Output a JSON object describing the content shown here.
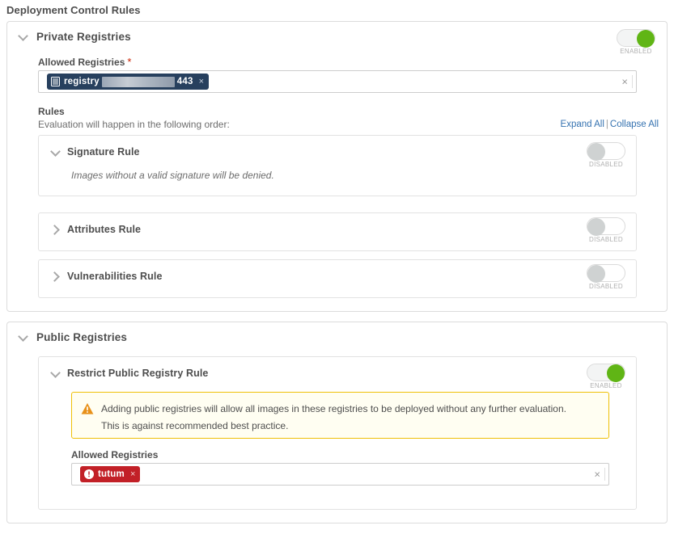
{
  "page": {
    "title": "Deployment Control Rules"
  },
  "private_section": {
    "title": "Private Registries",
    "chevron": "chevron-down-icon",
    "toggle": {
      "state": "on",
      "label": "ENABLED"
    },
    "allowed_registries": {
      "label": "Allowed Registries",
      "required_marker": "*",
      "clear_label": "×",
      "chips": [
        {
          "icon": "server-icon",
          "text_prefix": "registry",
          "redacted": true,
          "text_suffix": "443",
          "remove_label": "×"
        }
      ]
    },
    "rules": {
      "heading": "Rules",
      "subheading": "Evaluation will happen in the following order:",
      "expand_all": "Expand All",
      "separator": "|",
      "collapse_all": "Collapse All",
      "items": [
        {
          "title": "Signature Rule",
          "expanded": true,
          "chevron": "chevron-down-icon",
          "description": "Images without a valid signature will be denied.",
          "toggle": {
            "state": "off",
            "label": "DISABLED"
          }
        },
        {
          "title": "Attributes Rule",
          "expanded": false,
          "chevron": "chevron-right-icon",
          "description": "",
          "toggle": {
            "state": "off",
            "label": "DISABLED"
          }
        },
        {
          "title": "Vulnerabilities Rule",
          "expanded": false,
          "chevron": "chevron-right-icon",
          "description": "",
          "toggle": {
            "state": "off",
            "label": "DISABLED"
          }
        }
      ]
    }
  },
  "public_section": {
    "title": "Public Registries",
    "chevron": "chevron-down-icon",
    "rule": {
      "title": "Restrict Public Registry Rule",
      "chevron": "chevron-down-icon",
      "toggle": {
        "state": "on",
        "label": "ENABLED"
      },
      "alert": {
        "icon": "warning-triangle-icon",
        "line1": "Adding public registries will allow all images in these registries to be deployed without any further evaluation.",
        "line2": "This is against recommended best practice."
      },
      "allowed_registries": {
        "label": "Allowed Registries",
        "clear_label": "×",
        "chips": [
          {
            "icon": "exclamation-circle-icon",
            "text": "tutum",
            "remove_label": "×"
          }
        ]
      }
    }
  },
  "colors": {
    "toggle_on": "#60b515",
    "toggle_off": "#cfd2d2",
    "chip_dark": "#27405e",
    "chip_red": "#c22027",
    "alert_border": "#efc006",
    "alert_bg": "#fffef2",
    "link": "#3572b0",
    "required": "#c92100",
    "text": "#4e4e4e"
  }
}
